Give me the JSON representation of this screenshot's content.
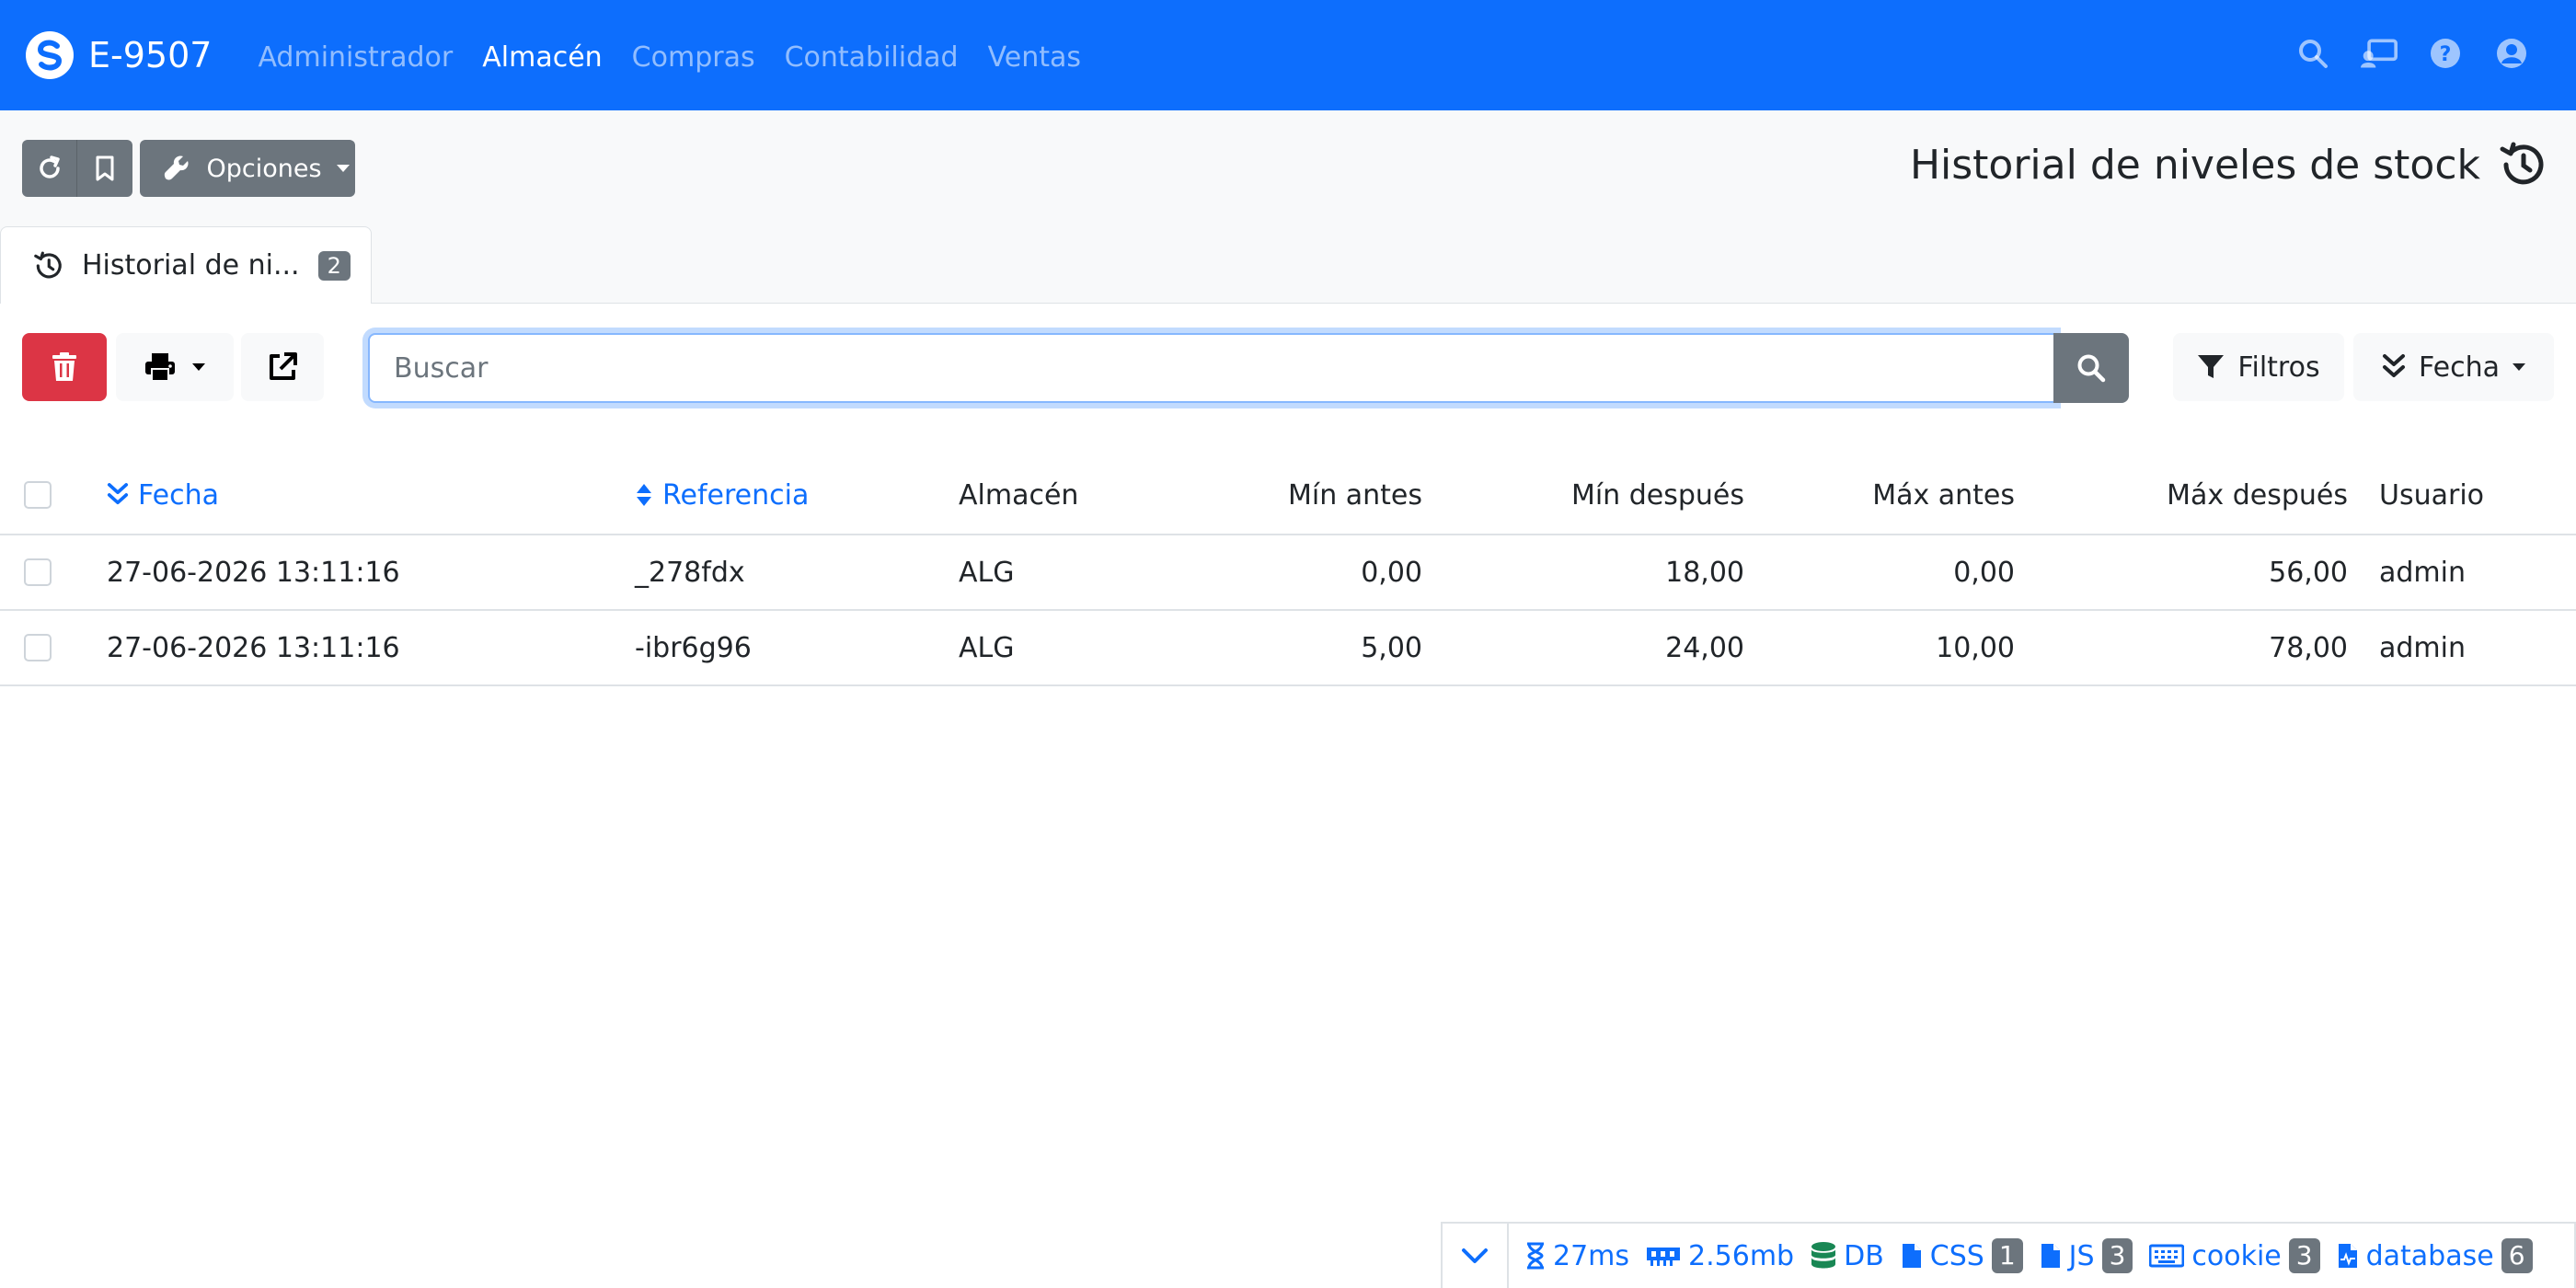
{
  "navbar": {
    "brand": "E-9507",
    "items": [
      "Administrador",
      "Almacén",
      "Compras",
      "Contabilidad",
      "Ventas"
    ],
    "active_index": 1,
    "icons": [
      "search-icon",
      "cast-icon",
      "help-icon",
      "user-icon"
    ]
  },
  "toolbar": {
    "options_label": "Opciones"
  },
  "page": {
    "title": "Historial de niveles de stock"
  },
  "tab": {
    "label": "Historial de ni...",
    "count": "2"
  },
  "list_toolbar": {
    "search_placeholder": "Buscar",
    "filters_label": "Filtros",
    "sort_label": "Fecha"
  },
  "table": {
    "columns": [
      "Fecha",
      "Referencia",
      "Almacén",
      "Mín antes",
      "Mín después",
      "Máx antes",
      "Máx después",
      "Usuario"
    ],
    "rows": [
      [
        "27-06-2026 13:11:16",
        "_278fdx",
        "ALG",
        "0,00",
        "18,00",
        "0,00",
        "56,00",
        "admin"
      ],
      [
        "27-06-2026 13:11:16",
        "-ibr6g96",
        "ALG",
        "5,00",
        "24,00",
        "10,00",
        "78,00",
        "admin"
      ]
    ]
  },
  "debugbar": {
    "time": "27ms",
    "memory": "2.56mb",
    "db": "DB",
    "css": "CSS",
    "css_count": "1",
    "js": "JS",
    "js_count": "3",
    "cookie": "cookie",
    "cookie_count": "3",
    "database": "database",
    "database_count": "6"
  },
  "colors": {
    "primary": "#0d6efd",
    "secondary": "#6c757d",
    "danger": "#dc3545",
    "success": "#198754"
  }
}
